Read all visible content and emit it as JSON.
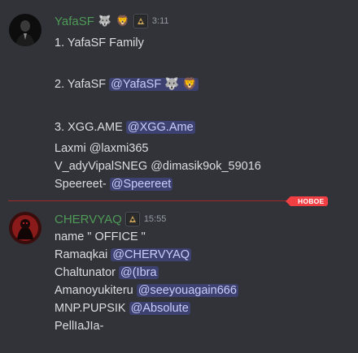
{
  "messages": [
    {
      "author": "YafaSF",
      "badges": [
        "🐺",
        "🦁"
      ],
      "time": "3:11",
      "lines": {
        "l1": "1. YafaSF Family",
        "l2_text": "2. YafaSF ",
        "l2_mention": "@YafaSF 🐺 🦁",
        "l3_text": "3. XGG.AME ",
        "l3_mention": "@XGG.Ame",
        "l4": "Laxmi @laxmi365",
        "l5": "V_adyVipalSNEG @dimasik9ok_59016",
        "l6_text": "Speereet- ",
        "l6_mention": "@Speereet"
      }
    },
    {
      "author": "CHERVYAQ",
      "time": "15:55",
      "lines": {
        "l1": "name \" OFFICE \"",
        "l2_text": "Ramaqkai ",
        "l2_mention": "@CHERVYAQ",
        "l3_text": "Chaltunator ",
        "l3_mention": "@(Ibra",
        "l4_text": "Amanoyukiteru ",
        "l4_mention": "@seeyouagain666",
        "l5_text": "MNP.PUPSIK ",
        "l5_mention": "@Absolute",
        "l6": "PellIaJIa-"
      }
    }
  ],
  "divider": {
    "label": "НОВОЕ",
    "color": "#f23f43"
  },
  "colors": {
    "background": "#313338",
    "username": "#4f9a57",
    "mention_bg": "#3c4270",
    "mention_text": "#c9cdfb"
  }
}
